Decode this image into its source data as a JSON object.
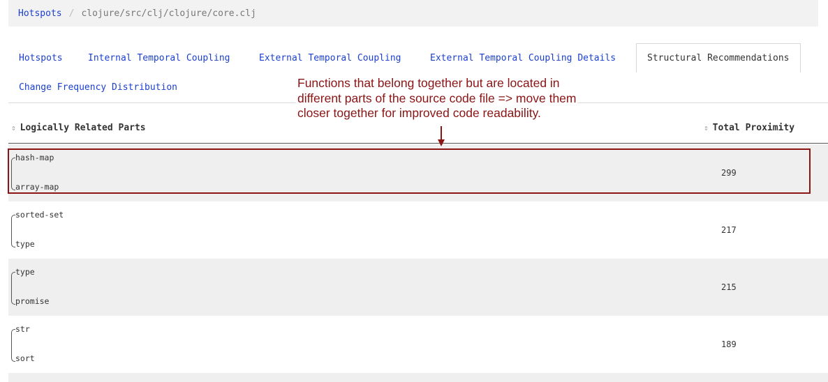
{
  "breadcrumb": {
    "link": "Hotspots",
    "separator": "/",
    "path": "clojure/src/clj/clojure/core.clj"
  },
  "tabs": [
    {
      "label": "Hotspots"
    },
    {
      "label": "Internal Temporal Coupling"
    },
    {
      "label": "External Temporal Coupling"
    },
    {
      "label": "External Temporal Coupling Details"
    },
    {
      "label": "Structural Recommendations",
      "active": true
    },
    {
      "label": "Change Frequency Distribution"
    }
  ],
  "annotation": {
    "lines": [
      "Functions that belong together but are located in",
      "different parts of the source code file => move them",
      "closer together for improved code readability."
    ],
    "color": "#8b1414"
  },
  "table": {
    "columns": [
      {
        "label": "Logically Related Parts",
        "sort_icon": "sort-icon"
      },
      {
        "label": "Total Proximity",
        "sort_icon": "sort-icon"
      }
    ],
    "rows": [
      {
        "part_a": "hash-map",
        "part_b": "array-map",
        "proximity": "299",
        "highlighted": true
      },
      {
        "part_a": "sorted-set",
        "part_b": "type",
        "proximity": "217"
      },
      {
        "part_a": "type",
        "part_b": "promise",
        "proximity": "215"
      },
      {
        "part_a": "str",
        "part_b": "sort",
        "proximity": "189"
      }
    ]
  },
  "colors": {
    "link": "#1a3fcf",
    "annotation": "#8b1414",
    "row_alt": "#efefef"
  }
}
